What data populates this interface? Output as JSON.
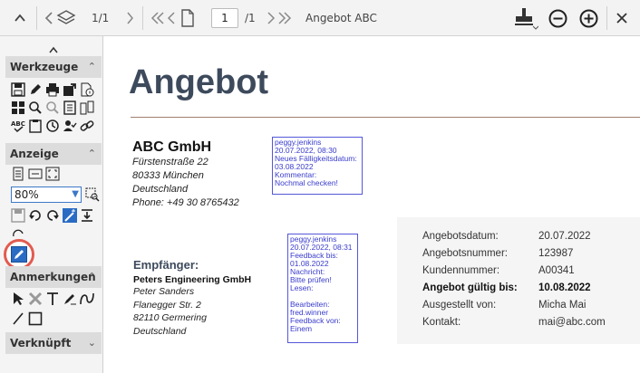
{
  "toolbar": {
    "page_count_current": "1/1",
    "page_input": "1",
    "page_total": "/1",
    "document_title": "Angebot ABC"
  },
  "sidebar": {
    "sections": [
      {
        "label": "Werkzeuge"
      },
      {
        "label": "Anzeige"
      },
      {
        "label": "Anmerkungen"
      },
      {
        "label": "Verknüpft"
      }
    ],
    "zoom_value": "80%"
  },
  "document": {
    "title": "Angebot",
    "company": {
      "name": "ABC GmbH",
      "lines": [
        "Fürstenstraße 22",
        "80333 München",
        "Deutschland",
        "Phone: +49 30 8765432"
      ]
    },
    "recipient": {
      "label": "Empfänger:",
      "firm": "Peters Engineering GmbH",
      "lines": [
        "Peter Sanders",
        "Flanegger Str. 2",
        "82110 Germering",
        "Deutschland"
      ]
    },
    "notes": [
      {
        "lines": [
          "peggy.jenkins",
          "20.07.2022, 08:30",
          "Neues Fälligkeitsdatum:",
          "03.08.2022",
          "Kommentar:",
          "Nochmal checken!"
        ]
      },
      {
        "lines": [
          "peggy.jenkins",
          "20.07.2022, 08:31",
          "Feedback bis:",
          "01.08.2022",
          "Nachricht:",
          "Bitte prüfen!",
          "Lesen:",
          "",
          "Bearbeiten:",
          "fred.winner",
          "Feedback von:",
          "Einem"
        ]
      }
    ],
    "info": [
      {
        "key": "Angebotsdatum:",
        "value": "20.07.2022",
        "bold": false
      },
      {
        "key": "Angebotsnummer:",
        "value": "123987",
        "bold": false
      },
      {
        "key": "Kundennummer:",
        "value": "A00341",
        "bold": false
      },
      {
        "key": "Angebot gültig bis:",
        "value": "10.08.2022",
        "bold": true
      },
      {
        "key": "Ausgestellt von:",
        "value": "Micha Mai",
        "bold": false
      },
      {
        "key": "Kontakt:",
        "value": "mai@abc.com",
        "bold": false
      }
    ]
  }
}
